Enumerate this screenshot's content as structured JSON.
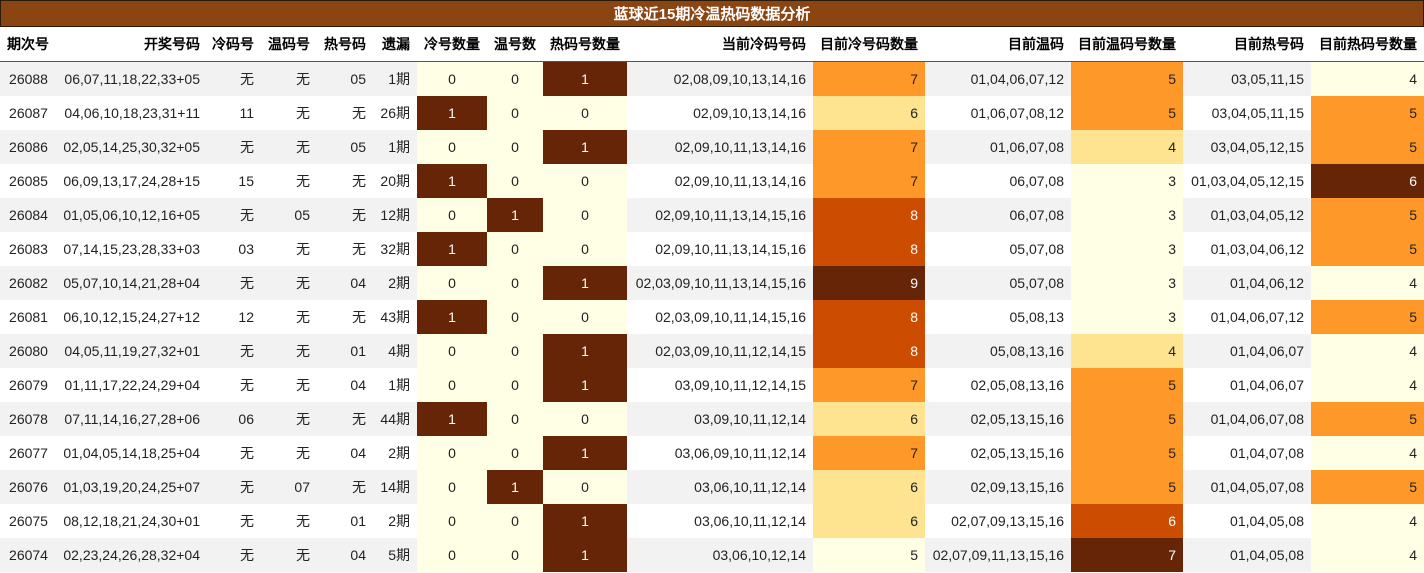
{
  "title": "蓝球近15期冷温热码数据分析",
  "columns": [
    "期次号",
    "开奖号码",
    "冷码号",
    "温码号",
    "热号码",
    "遗漏",
    "冷号数量",
    "温号数",
    "热码号数量",
    "当前冷码号码",
    "目前冷号码数量",
    "目前温码",
    "目前温码号数量",
    "目前热号码",
    "目前热码号数量"
  ],
  "rows": [
    [
      "26088",
      "06,07,11,18,22,33+05",
      "无",
      "无",
      "05",
      "1期",
      "0",
      "0",
      "1",
      "02,08,09,10,13,14,16",
      "7",
      "01,04,06,07,12",
      "5",
      "03,05,11,15",
      "4"
    ],
    [
      "26087",
      "04,06,10,18,23,31+11",
      "11",
      "无",
      "无",
      "26期",
      "1",
      "0",
      "0",
      "02,09,10,13,14,16",
      "6",
      "01,06,07,08,12",
      "5",
      "03,04,05,11,15",
      "5"
    ],
    [
      "26086",
      "02,05,14,25,30,32+05",
      "无",
      "无",
      "05",
      "1期",
      "0",
      "0",
      "1",
      "02,09,10,11,13,14,16",
      "7",
      "01,06,07,08",
      "4",
      "03,04,05,12,15",
      "5"
    ],
    [
      "26085",
      "06,09,13,17,24,28+15",
      "15",
      "无",
      "无",
      "20期",
      "1",
      "0",
      "0",
      "02,09,10,11,13,14,16",
      "7",
      "06,07,08",
      "3",
      "01,03,04,05,12,15",
      "6"
    ],
    [
      "26084",
      "01,05,06,10,12,16+05",
      "无",
      "05",
      "无",
      "12期",
      "0",
      "1",
      "0",
      "02,09,10,11,13,14,15,16",
      "8",
      "06,07,08",
      "3",
      "01,03,04,05,12",
      "5"
    ],
    [
      "26083",
      "07,14,15,23,28,33+03",
      "03",
      "无",
      "无",
      "32期",
      "1",
      "0",
      "0",
      "02,09,10,11,13,14,15,16",
      "8",
      "05,07,08",
      "3",
      "01,03,04,06,12",
      "5"
    ],
    [
      "26082",
      "05,07,10,14,21,28+04",
      "无",
      "无",
      "04",
      "2期",
      "0",
      "0",
      "1",
      "02,03,09,10,11,13,14,15,16",
      "9",
      "05,07,08",
      "3",
      "01,04,06,12",
      "4"
    ],
    [
      "26081",
      "06,10,12,15,24,27+12",
      "12",
      "无",
      "无",
      "43期",
      "1",
      "0",
      "0",
      "02,03,09,10,11,14,15,16",
      "8",
      "05,08,13",
      "3",
      "01,04,06,07,12",
      "5"
    ],
    [
      "26080",
      "04,05,11,19,27,32+01",
      "无",
      "无",
      "01",
      "4期",
      "0",
      "0",
      "1",
      "02,03,09,10,11,12,14,15",
      "8",
      "05,08,13,16",
      "4",
      "01,04,06,07",
      "4"
    ],
    [
      "26079",
      "01,11,17,22,24,29+04",
      "无",
      "无",
      "04",
      "1期",
      "0",
      "0",
      "1",
      "03,09,10,11,12,14,15",
      "7",
      "02,05,08,13,16",
      "5",
      "01,04,06,07",
      "4"
    ],
    [
      "26078",
      "07,11,14,16,27,28+06",
      "06",
      "无",
      "无",
      "44期",
      "1",
      "0",
      "0",
      "03,09,10,11,12,14",
      "6",
      "02,05,13,15,16",
      "5",
      "01,04,06,07,08",
      "5"
    ],
    [
      "26077",
      "01,04,05,14,18,25+04",
      "无",
      "无",
      "04",
      "2期",
      "0",
      "0",
      "1",
      "03,06,09,10,11,12,14",
      "7",
      "02,05,13,15,16",
      "5",
      "01,04,07,08",
      "4"
    ],
    [
      "26076",
      "01,03,19,20,24,25+07",
      "无",
      "07",
      "无",
      "14期",
      "0",
      "1",
      "0",
      "03,06,10,11,12,14",
      "6",
      "02,09,13,15,16",
      "5",
      "01,04,05,07,08",
      "5"
    ],
    [
      "26075",
      "08,12,18,21,24,30+01",
      "无",
      "无",
      "01",
      "2期",
      "0",
      "0",
      "1",
      "03,06,10,11,12,14",
      "6",
      "02,07,09,13,15,16",
      "6",
      "01,04,05,08",
      "4"
    ],
    [
      "26074",
      "02,23,24,26,28,32+04",
      "无",
      "无",
      "04",
      "5期",
      "0",
      "0",
      "1",
      "03,06,10,12,14",
      "5",
      "02,07,09,11,13,15,16",
      "7",
      "01,04,05,08",
      "4"
    ]
  ],
  "colors": {
    "title_bg": "#8B4513",
    "binary_zero": "#FFFFE5",
    "binary_one": "#662506",
    "scale_3": "#FFFFE5",
    "scale_4": "#FEE391",
    "scale_5": "#FE9929",
    "scale_6": "#CC4C02",
    "scale_7": "#662506"
  }
}
